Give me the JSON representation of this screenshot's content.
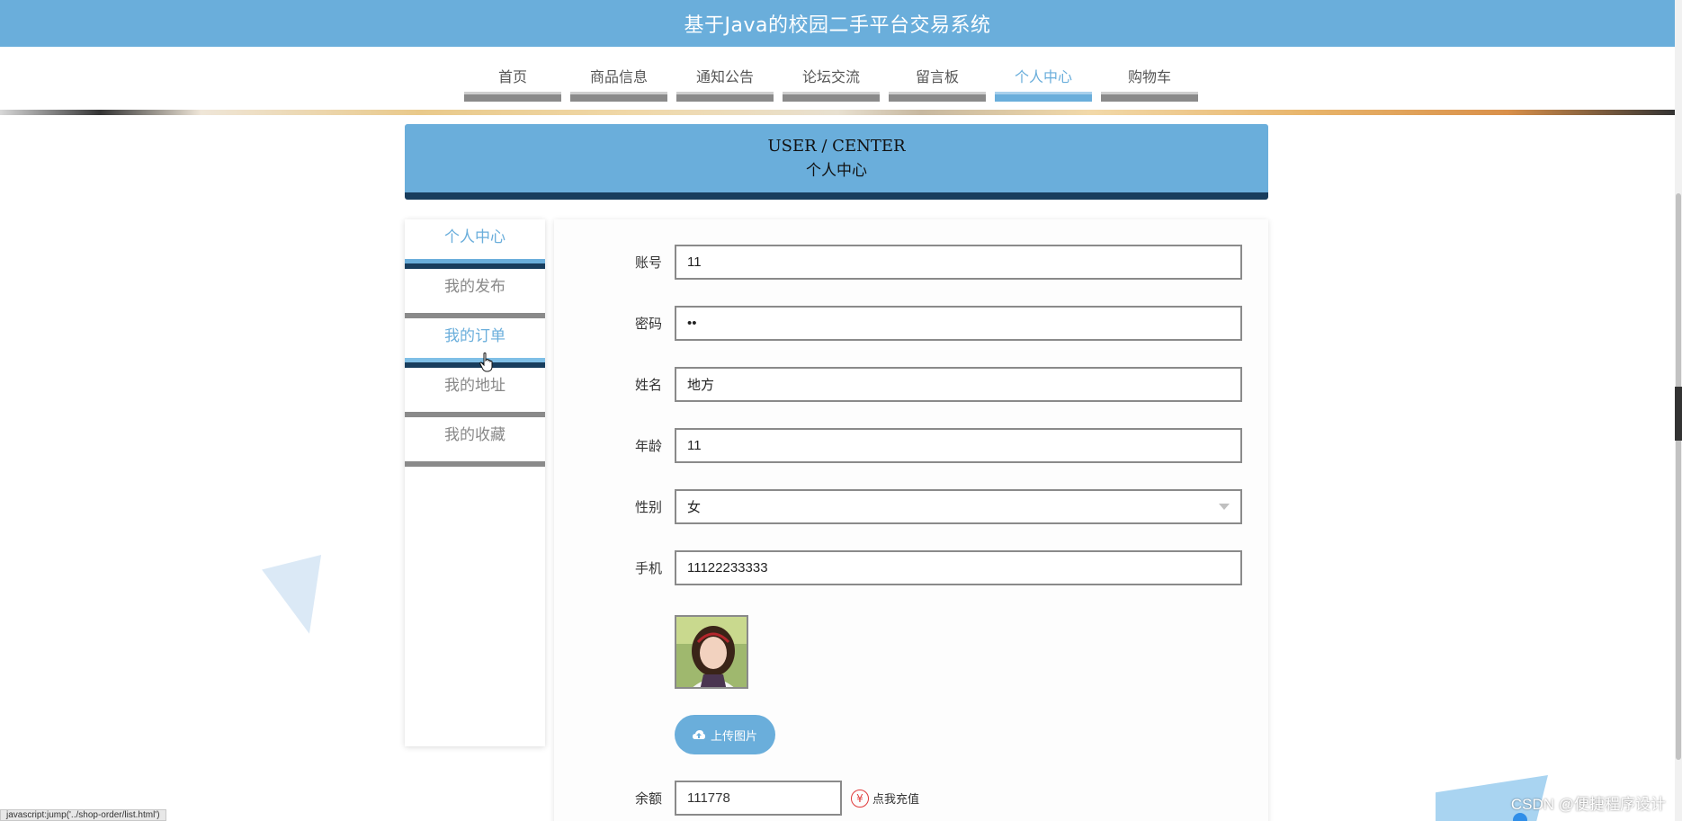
{
  "app": {
    "title": "基于Java的校园二手平台交易系统"
  },
  "nav": {
    "items": [
      {
        "label": "首页",
        "active": false
      },
      {
        "label": "商品信息",
        "active": false
      },
      {
        "label": "通知公告",
        "active": false
      },
      {
        "label": "论坛交流",
        "active": false
      },
      {
        "label": "留言板",
        "active": false
      },
      {
        "label": "个人中心",
        "active": true
      },
      {
        "label": "购物车",
        "active": false
      }
    ]
  },
  "banner": {
    "en": "USER / CENTER",
    "cn": "个人中心"
  },
  "sidebar": {
    "items": [
      {
        "label": "个人中心",
        "state": "active"
      },
      {
        "label": "我的发布",
        "state": "normal"
      },
      {
        "label": "我的订单",
        "state": "hover"
      },
      {
        "label": "我的地址",
        "state": "normal"
      },
      {
        "label": "我的收藏",
        "state": "normal"
      }
    ]
  },
  "form": {
    "account": {
      "label": "账号",
      "value": "11"
    },
    "password": {
      "label": "密码",
      "value": "••"
    },
    "name": {
      "label": "姓名",
      "value": "地方"
    },
    "age": {
      "label": "年龄",
      "value": "11"
    },
    "gender": {
      "label": "性别",
      "value": "女"
    },
    "phone": {
      "label": "手机",
      "value": "11122233333"
    },
    "upload_label": "上传图片",
    "balance": {
      "label": "余额",
      "value": "111778"
    },
    "recharge_label": "点我充值",
    "recharge_symbol": "¥"
  },
  "status_bar": "javascript:jump('../shop-order/list.html')",
  "watermark": "CSDN @便捷程序设计",
  "colors": {
    "primary": "#6aaedb",
    "dark": "#183d5d",
    "gray_bar": "#8a8a8a"
  }
}
